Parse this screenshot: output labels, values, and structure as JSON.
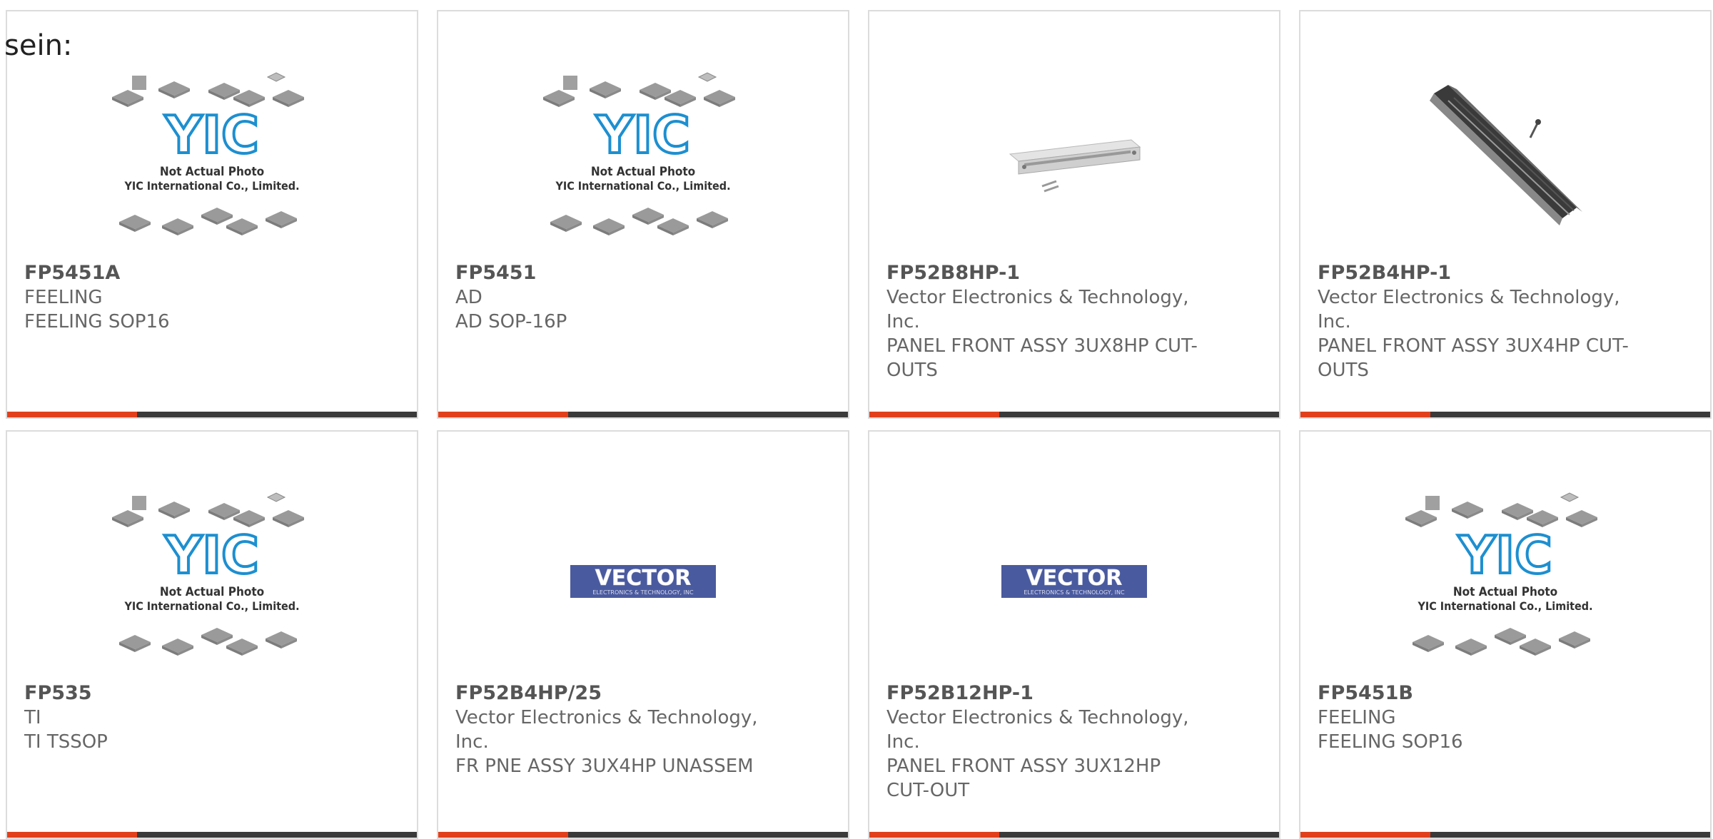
{
  "intro_text": "sein:",
  "colors": {
    "accent": "#e2401c",
    "bar": "#3a3a3a",
    "border": "#dcdcdc",
    "yic_blue": "#1d8fd0",
    "vector_blue": "#4a5a9e"
  },
  "placeholder": {
    "logo": "YIC",
    "line1": "Not Actual Photo",
    "line2": "YIC International Co., Limited."
  },
  "vector_logo": {
    "wordmark": "VECTOR",
    "tagline": "ELECTRONICS & TECHNOLOGY, INC"
  },
  "products": [
    {
      "part_number": "FP5451A",
      "manufacturer": "FEELING",
      "description": "FEELING SOP16",
      "image": "yic-placeholder"
    },
    {
      "part_number": "FP5451",
      "manufacturer": "AD",
      "description": "AD SOP-16P",
      "image": "yic-placeholder"
    },
    {
      "part_number": "FP52B8HP-1",
      "manufacturer": "Vector Electronics & Technology, Inc.",
      "description": "PANEL FRONT ASSY 3UX8HP CUT-OUTS",
      "image": "panel-photo"
    },
    {
      "part_number": "FP52B4HP-1",
      "manufacturer": "Vector Electronics & Technology, Inc.",
      "description": "PANEL FRONT ASSY 3UX4HP CUT-OUTS",
      "image": "rail-photo"
    },
    {
      "part_number": "FP535",
      "manufacturer": "TI",
      "description": "TI TSSOP",
      "image": "yic-placeholder"
    },
    {
      "part_number": "FP52B4HP/25",
      "manufacturer": "Vector Electronics & Technology, Inc.",
      "description": "FR PNE ASSY 3UX4HP UNASSEM",
      "image": "vector-logo"
    },
    {
      "part_number": "FP52B12HP-1",
      "manufacturer": "Vector Electronics & Technology, Inc.",
      "description": "PANEL FRONT ASSY 3UX12HP CUT-OUT",
      "image": "vector-logo"
    },
    {
      "part_number": "FP5451B",
      "manufacturer": "FEELING",
      "description": "FEELING SOP16",
      "image": "yic-placeholder"
    }
  ]
}
